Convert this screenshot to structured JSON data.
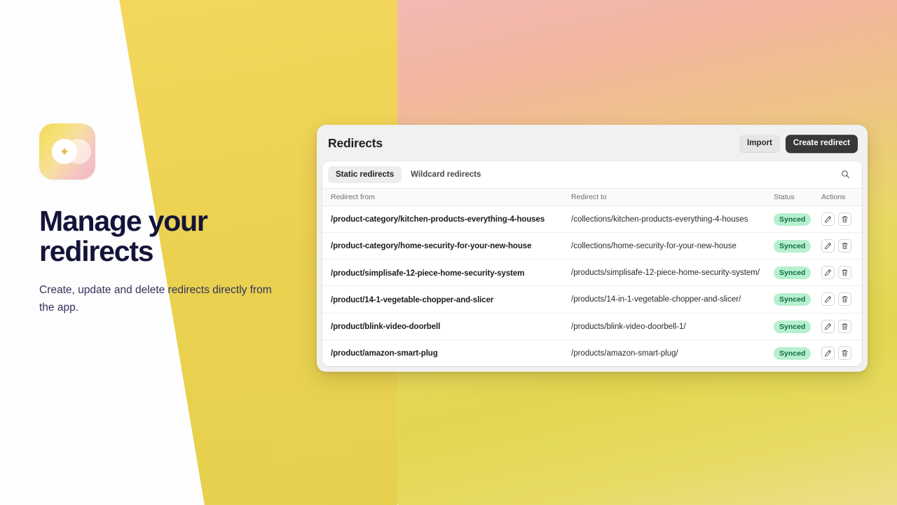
{
  "hero": {
    "logo_icon": "sparkle-circles-logo",
    "headline": "Manage your redirects",
    "subhead": "Create, update and delete redirects directly from the app."
  },
  "card": {
    "title": "Redirects",
    "import_label": "Import",
    "create_label": "Create redirect",
    "search_icon": "search-icon",
    "tabs": [
      {
        "label": "Static redirects",
        "active": true
      },
      {
        "label": "Wildcard redirects",
        "active": false
      }
    ],
    "columns": {
      "from": "Redirect from",
      "to": "Redirect to",
      "status": "Status",
      "actions": "Actions"
    },
    "rows": [
      {
        "from": "/product-category/kitchen-products-everything-4-houses",
        "to": "/collections/kitchen-products-everything-4-houses",
        "status": "Synced",
        "edit_icon": "pencil-icon",
        "delete_icon": "trash-icon"
      },
      {
        "from": "/product-category/home-security-for-your-new-house",
        "to": "/collections/home-security-for-your-new-house",
        "status": "Synced",
        "edit_icon": "pencil-icon",
        "delete_icon": "trash-icon"
      },
      {
        "from": "/product/simplisafe-12-piece-home-security-system",
        "to": "/products/simplisafe-12-piece-home-security-system/",
        "status": "Synced",
        "edit_icon": "pencil-icon",
        "delete_icon": "trash-icon"
      },
      {
        "from": "/product/14-1-vegetable-chopper-and-slicer",
        "to": "/products/14-in-1-vegetable-chopper-and-slicer/",
        "status": "Synced",
        "edit_icon": "pencil-icon",
        "delete_icon": "trash-icon"
      },
      {
        "from": "/product/blink-video-doorbell",
        "to": "/products/blink-video-doorbell-1/",
        "status": "Synced",
        "edit_icon": "pencil-icon",
        "delete_icon": "trash-icon"
      },
      {
        "from": "/product/amazon-smart-plug",
        "to": "/products/amazon-smart-plug/",
        "status": "Synced",
        "edit_icon": "pencil-icon",
        "delete_icon": "trash-icon"
      }
    ]
  },
  "colors": {
    "headline": "#141439",
    "primary_button": "#383838",
    "status_badge_bg": "#b6f0cf",
    "status_badge_text": "#0f6b45",
    "accent_yellow": "#ecd24f",
    "accent_pink": "#f4b9b2"
  }
}
